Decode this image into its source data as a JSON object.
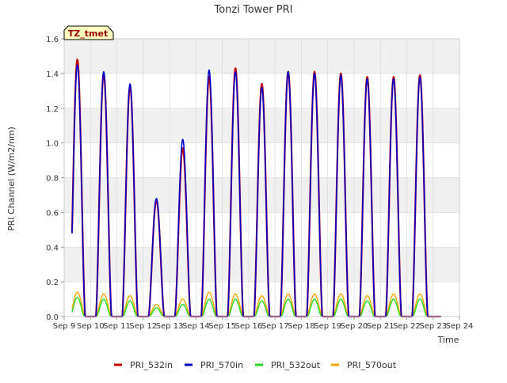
{
  "chart_data": {
    "type": "line",
    "title": "Tonzi Tower PRI",
    "xlabel": "Time",
    "ylabel": "PRI Channel (W/m2/nm)",
    "badge": "TZ_tmet",
    "xlim": [
      9,
      24
    ],
    "ylim": [
      0,
      1.6
    ],
    "xticks": [
      9,
      10,
      11,
      12,
      13,
      14,
      15,
      16,
      17,
      18,
      19,
      20,
      21,
      22,
      23,
      24
    ],
    "xtick_labels": [
      "Sep 9",
      "Sep 10",
      "Sep 11",
      "Sep 12",
      "Sep 13",
      "Sep 14",
      "Sep 15",
      "Sep 16",
      "Sep 17",
      "Sep 18",
      "Sep 19",
      "Sep 20",
      "Sep 21",
      "Sep 22",
      "Sep 23",
      "Sep 24"
    ],
    "yticks": [
      0.0,
      0.2,
      0.4,
      0.6,
      0.8,
      1.0,
      1.2,
      1.4,
      1.6
    ],
    "ytick_labels": [
      "0.0",
      "0.2",
      "0.4",
      "0.6",
      "0.8",
      "1.0",
      "1.2",
      "1.4",
      "1.6"
    ],
    "grid": true,
    "legend_position": "bottom",
    "series": [
      {
        "name": "PRI_532in",
        "color": "#cc0000"
      },
      {
        "name": "PRI_570in",
        "color": "#0000cc"
      },
      {
        "name": "PRI_532out",
        "color": "#22dd22"
      },
      {
        "name": "PRI_570out",
        "color": "#ffa500"
      }
    ],
    "daily_peaks": [
      {
        "day": "Sep 10",
        "noon": 9.5,
        "PRI_532in": 1.48,
        "PRI_570in": 1.45,
        "PRI_532out": 0.11,
        "PRI_570out": 0.14
      },
      {
        "day": "Sep 11",
        "noon": 10.5,
        "PRI_532in": 1.4,
        "PRI_570in": 1.41,
        "PRI_532out": 0.1,
        "PRI_570out": 0.13
      },
      {
        "day": "Sep 12",
        "noon": 11.5,
        "PRI_532in": 1.33,
        "PRI_570in": 1.34,
        "PRI_532out": 0.09,
        "PRI_570out": 0.12
      },
      {
        "day": "Sep 13",
        "noon": 12.5,
        "PRI_532in": 0.67,
        "PRI_570in": 0.68,
        "PRI_532out": 0.05,
        "PRI_570out": 0.07
      },
      {
        "day": "Sep 14",
        "noon": 13.5,
        "PRI_532in": 0.97,
        "PRI_570in": 1.02,
        "PRI_532out": 0.07,
        "PRI_570out": 0.1
      },
      {
        "day": "Sep 15",
        "noon": 14.5,
        "PRI_532in": 1.38,
        "PRI_570in": 1.42,
        "PRI_532out": 0.1,
        "PRI_570out": 0.14
      },
      {
        "day": "Sep 16",
        "noon": 15.5,
        "PRI_532in": 1.43,
        "PRI_570in": 1.41,
        "PRI_532out": 0.1,
        "PRI_570out": 0.13
      },
      {
        "day": "Sep 17",
        "noon": 16.5,
        "PRI_532in": 1.34,
        "PRI_570in": 1.32,
        "PRI_532out": 0.09,
        "PRI_570out": 0.12
      },
      {
        "day": "Sep 18",
        "noon": 17.5,
        "PRI_532in": 1.41,
        "PRI_570in": 1.41,
        "PRI_532out": 0.1,
        "PRI_570out": 0.13
      },
      {
        "day": "Sep 19",
        "noon": 18.5,
        "PRI_532in": 1.41,
        "PRI_570in": 1.4,
        "PRI_532out": 0.1,
        "PRI_570out": 0.13
      },
      {
        "day": "Sep 20",
        "noon": 19.5,
        "PRI_532in": 1.4,
        "PRI_570in": 1.39,
        "PRI_532out": 0.1,
        "PRI_570out": 0.13
      },
      {
        "day": "Sep 21",
        "noon": 20.5,
        "PRI_532in": 1.38,
        "PRI_570in": 1.37,
        "PRI_532out": 0.09,
        "PRI_570out": 0.12
      },
      {
        "day": "Sep 22",
        "noon": 21.5,
        "PRI_532in": 1.38,
        "PRI_570in": 1.37,
        "PRI_532out": 0.1,
        "PRI_570out": 0.13
      },
      {
        "day": "Sep 23",
        "noon": 22.5,
        "PRI_532in": 1.39,
        "PRI_570in": 1.38,
        "PRI_532out": 0.1,
        "PRI_570out": 0.13
      }
    ]
  }
}
